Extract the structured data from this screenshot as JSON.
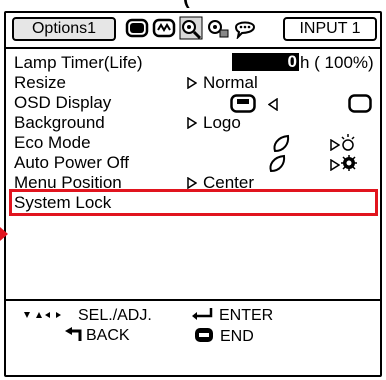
{
  "header": {
    "top_fragment": "(",
    "tab_label": "Options1",
    "input_label": "INPUT 1",
    "mode_icons": [
      "picture-mode-icon",
      "sound-mode-icon",
      "options1-icon",
      "options2-icon",
      "language-icon"
    ]
  },
  "menu": {
    "lamp": {
      "label": "Lamp Timer(Life)",
      "value": "0",
      "suffix": "h ( 100%)"
    },
    "resize": {
      "label": "Resize",
      "value": "Normal"
    },
    "osd": {
      "label": "OSD Display"
    },
    "background": {
      "label": "Background",
      "value": "Logo"
    },
    "eco": {
      "label": "Eco Mode"
    },
    "autopower": {
      "label": "Auto Power Off"
    },
    "position": {
      "label": "Menu Position",
      "value": "Center"
    },
    "syslock": {
      "label": "System Lock"
    }
  },
  "footer": {
    "sel": "SEL./ADJ.",
    "enter": "ENTER",
    "back": "BACK",
    "end": "END"
  },
  "colors": {
    "highlight": "#e1141e"
  }
}
